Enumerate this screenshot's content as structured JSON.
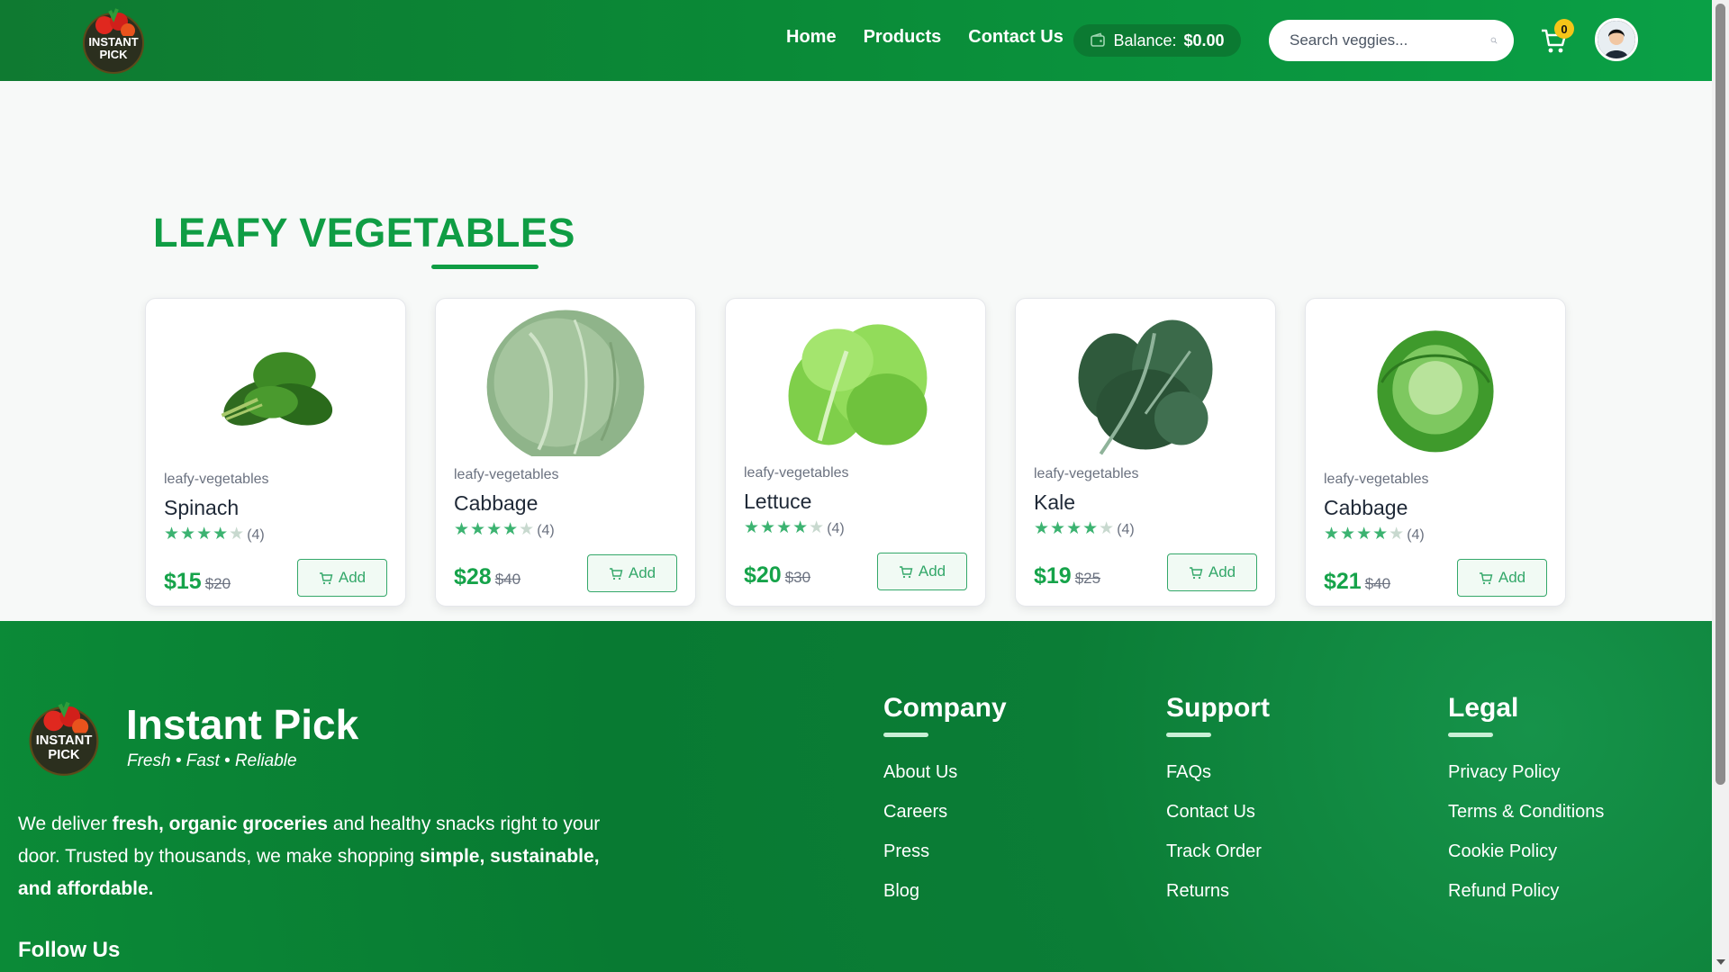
{
  "header": {
    "logo_text": "INSTANT PICK",
    "nav": [
      {
        "label": "Home"
      },
      {
        "label": "Products"
      },
      {
        "label": "Contact Us"
      }
    ],
    "balance_label": "Balance:",
    "balance_amount": "$0.00",
    "search_placeholder": "Search veggies...",
    "cart_count": "0",
    "icons": [
      "wallet-icon",
      "search-icon",
      "cart-icon",
      "avatar"
    ]
  },
  "main": {
    "section_title": "LEAFY VEGETABLES",
    "products": [
      {
        "category": "leafy-vegetables",
        "name": "Spinach",
        "rating": 4,
        "review_count": "(4)",
        "price": "$15",
        "old_price": "$20",
        "add_label": "Add"
      },
      {
        "category": "leafy-vegetables",
        "name": "Cabbage",
        "rating": 4,
        "review_count": "(4)",
        "price": "$28",
        "old_price": "$40",
        "add_label": "Add"
      },
      {
        "category": "leafy-vegetables",
        "name": "Lettuce",
        "rating": 4,
        "review_count": "(4)",
        "price": "$20",
        "old_price": "$30",
        "add_label": "Add"
      },
      {
        "category": "leafy-vegetables",
        "name": "Kale",
        "rating": 4,
        "review_count": "(4)",
        "price": "$19",
        "old_price": "$25",
        "add_label": "Add"
      },
      {
        "category": "leafy-vegetables",
        "name": "Cabbage",
        "rating": 4,
        "review_count": "(4)",
        "price": "$21",
        "old_price": "$40",
        "add_label": "Add"
      }
    ]
  },
  "footer": {
    "brand": "Instant Pick",
    "tagline": "Fresh • Fast • Reliable",
    "about_parts": [
      "We deliver ",
      "fresh, organic groceries",
      " and healthy snacks right to your door. Trusted by thousands, we make shopping ",
      "simple, sustainable, and affordable."
    ],
    "follow_us": "Follow Us",
    "columns": [
      {
        "title": "Company",
        "links": [
          "About Us",
          "Careers",
          "Press",
          "Blog"
        ]
      },
      {
        "title": "Support",
        "links": [
          "FAQs",
          "Contact Us",
          "Track Order",
          "Returns"
        ]
      },
      {
        "title": "Legal",
        "links": [
          "Privacy Policy",
          "Terms & Conditions",
          "Cookie Policy",
          "Refund Policy"
        ]
      }
    ]
  },
  "colors": {
    "brand_green": "#0f9d44",
    "header_green": "#0a8a37",
    "footer_green": "#087a32",
    "price_green": "#16a34a",
    "badge_yellow": "#f5c518"
  }
}
